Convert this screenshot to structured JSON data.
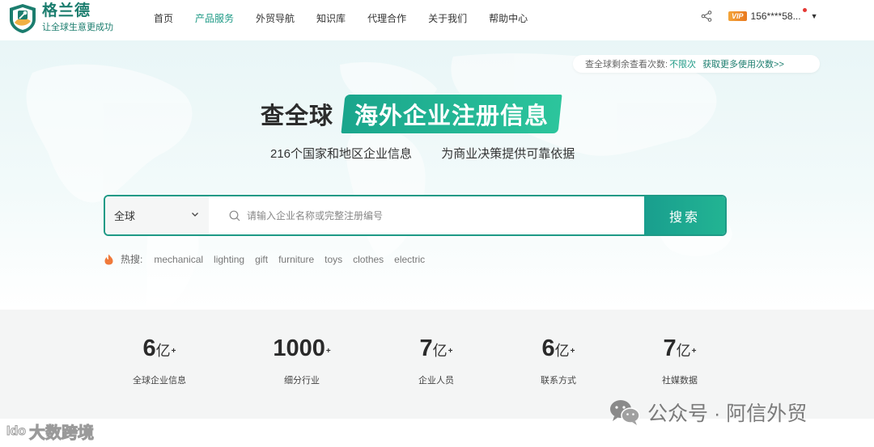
{
  "brand": {
    "name": "格兰德",
    "slogan": "让全球生意更成功"
  },
  "nav": {
    "items": [
      {
        "label": "首页"
      },
      {
        "label": "产品服务"
      },
      {
        "label": "外贸导航"
      },
      {
        "label": "知识库"
      },
      {
        "label": "代理合作"
      },
      {
        "label": "关于我们"
      },
      {
        "label": "帮助中心"
      }
    ],
    "active_index": 1
  },
  "user": {
    "vip_label": "VIP",
    "phone": "156****58..."
  },
  "quota": {
    "label": "查全球剩余查看次数:",
    "value": "不限次",
    "more_link": "获取更多使用次数>>"
  },
  "hero": {
    "title_plain": "查全球",
    "title_highlight": "海外企业注册信息",
    "subtitle_1": "216个国家和地区企业信息",
    "subtitle_2": "为商业决策提供可靠依据"
  },
  "search": {
    "region_value": "全球",
    "placeholder": "请输入企业名称或完整注册编号",
    "button_label": "搜索"
  },
  "hot": {
    "label": "热搜:",
    "keywords": [
      "mechanical",
      "lighting",
      "gift",
      "furniture",
      "toys",
      "clothes",
      "electric"
    ]
  },
  "stats": [
    {
      "number": "6",
      "unit": "亿",
      "sup": "+",
      "label": "全球企业信息"
    },
    {
      "number": "1000",
      "unit": "",
      "sup": "+",
      "label": "细分行业"
    },
    {
      "number": "7",
      "unit": "亿",
      "sup": "+",
      "label": "企业人员"
    },
    {
      "number": "6",
      "unit": "亿",
      "sup": "+",
      "label": "联系方式"
    },
    {
      "number": "7",
      "unit": "亿",
      "sup": "+",
      "label": "社媒数据"
    }
  ],
  "watermarks": {
    "left_logo": "Ido",
    "left_text": "大数跨境",
    "right_text": "公众号 · 阿信外贸"
  },
  "colors": {
    "brand": "#1b7d6e",
    "accent": "#1e9a86",
    "vip": "#f3a53a"
  }
}
